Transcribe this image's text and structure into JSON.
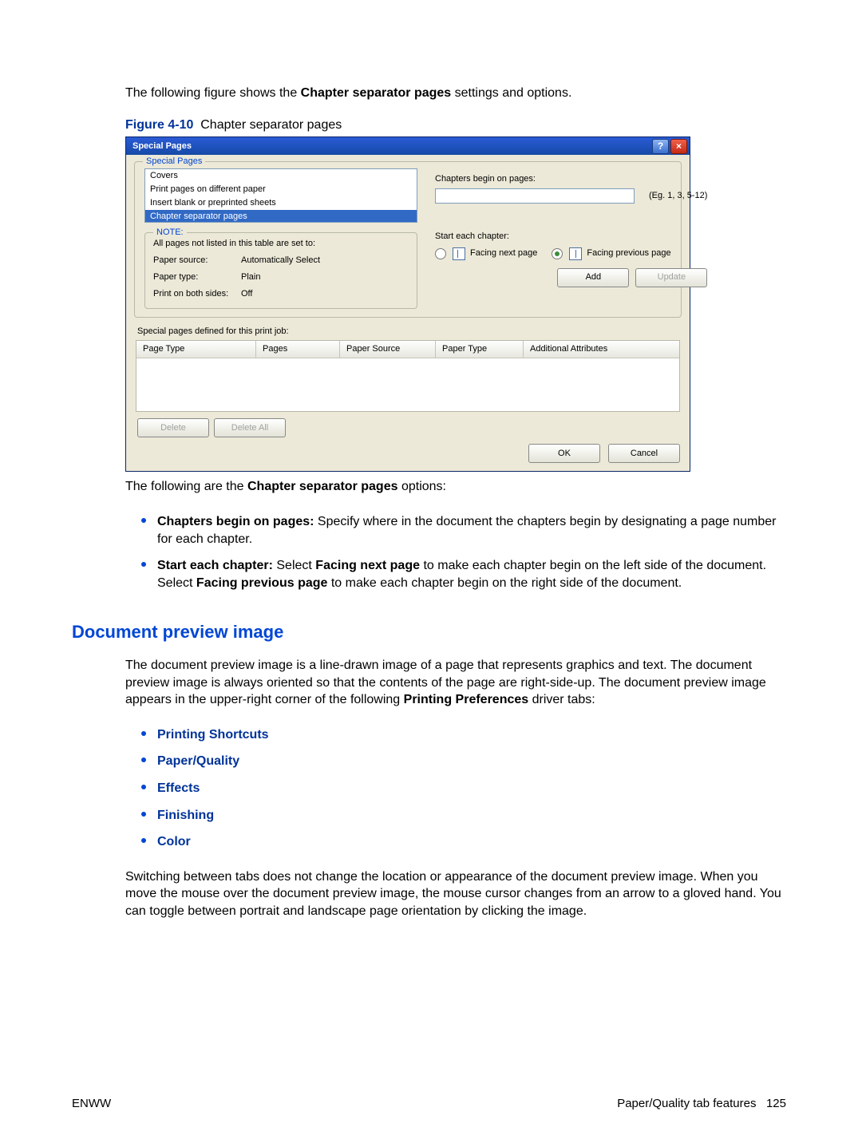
{
  "intro": {
    "pre": "The following figure shows the ",
    "bold": "Chapter separator pages",
    "post": " settings and options."
  },
  "figure": {
    "label": "Figure 4-10",
    "caption": "Chapter separator pages"
  },
  "dialog": {
    "title": "Special Pages",
    "help": "?",
    "close": "×",
    "group_title": "Special Pages",
    "list_items": {
      "0": "Covers",
      "1": "Print pages on different paper",
      "2": "Insert blank or preprinted sheets",
      "3": "Chapter separator pages"
    },
    "chap_label": "Chapters begin on pages:",
    "chap_input": "",
    "chap_hint": "(Eg. 1, 3, 5-12)",
    "note_title": "NOTE:",
    "note_text": "All pages not listed in this table are set to:",
    "kv": {
      "ps_k": "Paper source:",
      "ps_v": "Automatically Select",
      "pt_k": "Paper type:",
      "pt_v": "Plain",
      "bs_k": "Print on both sides:",
      "bs_v": "Off"
    },
    "start_label": "Start each chapter:",
    "radio_next": "Facing next page",
    "radio_prev": "Facing previous page",
    "add_btn": "Add",
    "update_btn": "Update",
    "defined_label": "Special pages defined for this print job:",
    "cols": {
      "c1": "Page Type",
      "c2": "Pages",
      "c3": "Paper Source",
      "c4": "Paper Type",
      "c5": "Additional Attributes"
    },
    "delete_btn": "Delete",
    "delete_all_btn": "Delete All",
    "ok_btn": "OK",
    "cancel_btn": "Cancel"
  },
  "after_dialog": {
    "pre": "The following are the ",
    "bold": "Chapter separator pages",
    "post": " options:"
  },
  "opts": {
    "a_bold": "Chapters begin on pages:",
    "a_rest": " Specify where in the document the chapters begin by designating a page number for each chapter.",
    "b_bold1": "Start each chapter:",
    "b_mid1": " Select ",
    "b_bold2": "Facing next page",
    "b_mid2": " to make each chapter begin on the left side of the document. Select ",
    "b_bold3": "Facing previous page",
    "b_mid3": " to make each chapter begin on the right side of the document."
  },
  "h2": "Document preview image",
  "preview_p1_pre": "The document preview image is a line-drawn image of a page that represents graphics and text. The document preview image is always oriented so that the contents of the page are right-side-up. The document preview image appears in the upper-right corner of the following ",
  "preview_p1_bold": "Printing Preferences",
  "preview_p1_post": " driver tabs:",
  "tabs": {
    "t1": "Printing Shortcuts",
    "t2": "Paper/Quality",
    "t3": "Effects",
    "t4": "Finishing",
    "t5": "Color"
  },
  "preview_p2": "Switching between tabs does not change the location or appearance of the document preview image. When you move the mouse over the document preview image, the mouse cursor changes from an arrow to a gloved hand. You can toggle between portrait and landscape page orientation by clicking the image.",
  "footer": {
    "left": "ENWW",
    "right_label": "Paper/Quality tab features",
    "right_page": "125"
  }
}
